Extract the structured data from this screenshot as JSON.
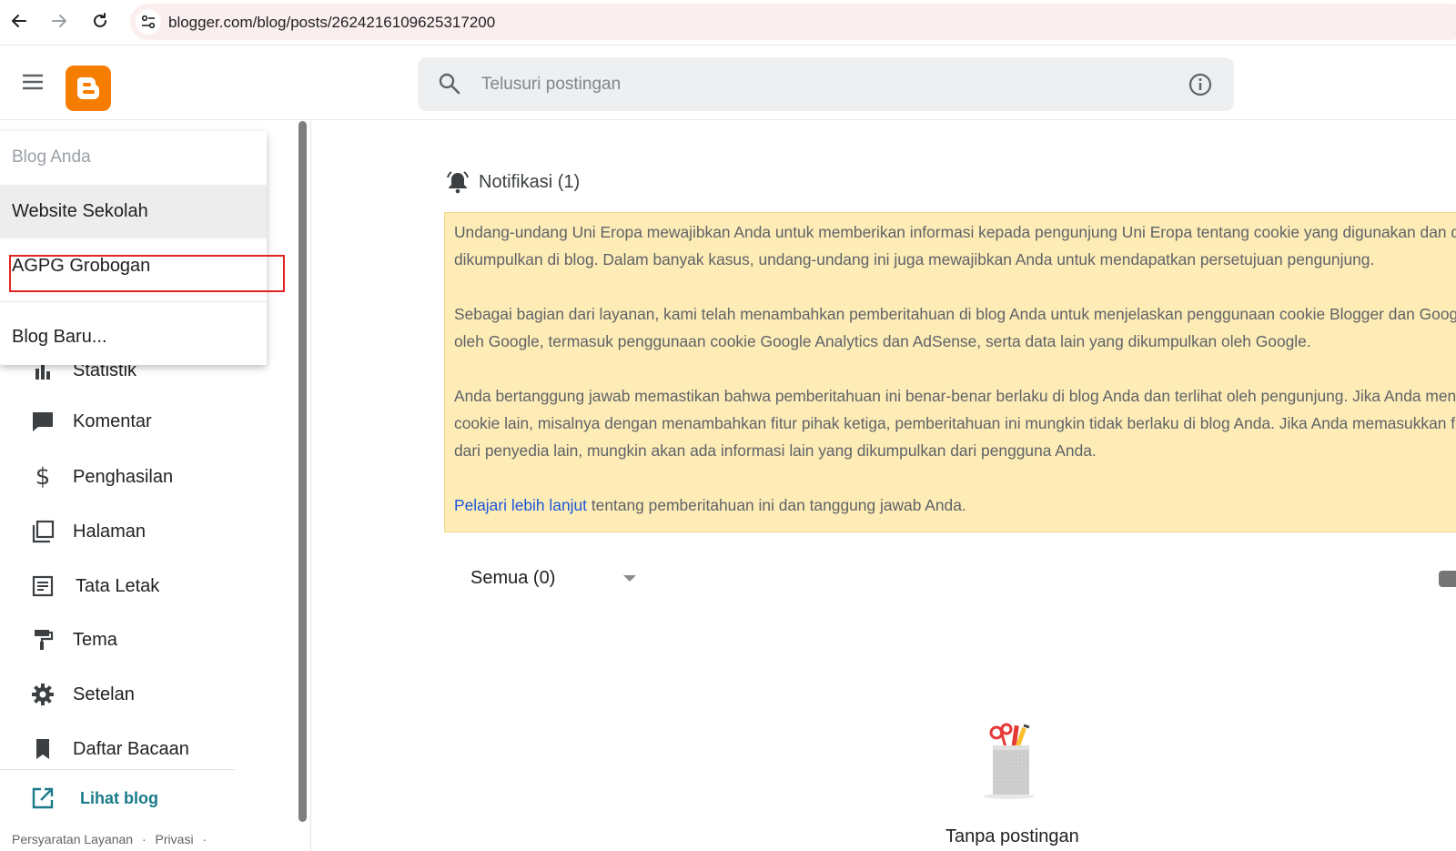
{
  "browser": {
    "url": "blogger.com/blog/posts/2624216109625317200"
  },
  "header": {
    "search_placeholder": "Telusuri postingan"
  },
  "dropdown": {
    "header": "Blog Anda",
    "items": [
      {
        "label": "Website Sekolah"
      },
      {
        "label": "AGPG Grobogan"
      }
    ],
    "new_blog": "Blog Baru...",
    "peek_label": "Statistik"
  },
  "sidebar": {
    "items": [
      {
        "label": "Komentar",
        "icon": "comment-icon"
      },
      {
        "label": "Penghasilan",
        "icon": "dollar-icon"
      },
      {
        "label": "Halaman",
        "icon": "pages-icon"
      },
      {
        "label": "Tata Letak",
        "icon": "layout-icon"
      },
      {
        "label": "Tema",
        "icon": "paint-roller-icon"
      },
      {
        "label": "Setelan",
        "icon": "gear-icon"
      },
      {
        "label": "Daftar Bacaan",
        "icon": "bookmark-icon"
      }
    ],
    "view_blog": "Lihat blog",
    "footer": {
      "terms": "Persyaratan Layanan",
      "privacy": "Privasi"
    }
  },
  "main": {
    "notification_title": "Notifikasi (1)",
    "notice": {
      "line1": "Undang-undang Uni Eropa mewajibkan Anda untuk memberikan informasi kepada pengunjung Uni Eropa tentang cookie yang digunakan dan da",
      "line2": "dikumpulkan di blog. Dalam banyak kasus, undang-undang ini juga mewajibkan Anda untuk mendapatkan persetujuan pengunjung.",
      "line3": "Sebagai bagian dari layanan, kami telah menambahkan pemberitahuan di blog Anda untuk menjelaskan penggunaan cookie Blogger dan Google",
      "line4": "oleh Google, termasuk penggunaan cookie Google Analytics dan AdSense, serta data lain yang dikumpulkan oleh Google.",
      "line5": "Anda bertanggung jawab memastikan bahwa pemberitahuan ini benar-benar berlaku di blog Anda dan terlihat oleh pengunjung. Jika Anda meng",
      "line6": "cookie lain, misalnya dengan menambahkan fitur pihak ketiga, pemberitahuan ini mungkin tidak berlaku di blog Anda. Jika Anda memasukkan f",
      "line7": "dari penyedia lain, mungkin akan ada informasi lain yang dikumpulkan dari pengguna Anda.",
      "link": "Pelajari lebih lanjut",
      "link_suffix": " tentang pemberitahuan ini dan tanggung jawab Anda."
    },
    "filter_label": "Semua (0)",
    "empty_text": "Tanpa postingan"
  },
  "colors": {
    "brand_orange": "#f57d00",
    "notice_bg": "#feecb6",
    "link_blue": "#1a56db",
    "highlight_red": "#e02424",
    "view_blog_teal": "#1a7a8a"
  }
}
